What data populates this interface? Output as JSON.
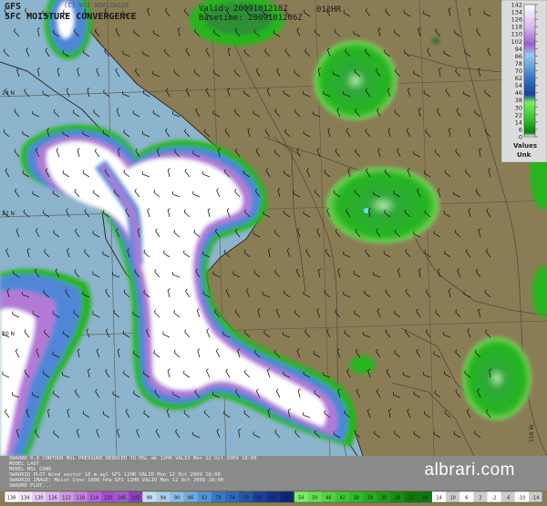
{
  "header": {
    "model": "GFS",
    "product": "SFC MOISTURE CONVERGENCE",
    "copyright": "(C) WSI WORLDWIDE",
    "valid": "Valid: 2009101218Z",
    "basetime": "Basetime: 2009101206Z",
    "forecast_hour": "012HR"
  },
  "legend": {
    "ticks": [
      "142",
      "134",
      "126",
      "118",
      "110",
      "102",
      "94",
      "86",
      "78",
      "70",
      "62",
      "54",
      "46",
      "38",
      "30",
      "22",
      "14",
      "6",
      "0"
    ],
    "caption_line1": "Values",
    "caption_line2": "Unk"
  },
  "latitude_labels": [
    "24 N",
    "22 N",
    "20 N"
  ],
  "longitude_labels": [
    "116 W"
  ],
  "info_lines": [
    "SWAORD 0.0 CONTOUR MSL PRESSURE REDUCED TO MSL mb 12HR VALID Mon 12 Oct 2009 18:00",
    "MODEL LAST",
    "MODEL MSL CONV",
    "SWAORID PLOT Wind vector 10 m agl GFS 12HR VALID Mon 12 Oct 2009 18:00",
    "SWAORID IMAGE: Moist Conv 1000 hPa GFS 12HR VALID Mon 12 Oct 2009 18:00",
    "SWAORD PLOT..."
  ],
  "bottom_colorbar": {
    "labels": [
      "138",
      "134",
      "130",
      "126",
      "122",
      "118",
      "114",
      "110",
      "106",
      "102",
      "98",
      "94",
      "90",
      "86",
      "82",
      "78",
      "74",
      "70",
      "66",
      "62",
      "58",
      "54",
      "50",
      "46",
      "42",
      "38",
      "34",
      "30",
      "26",
      "22",
      "18",
      "14",
      "10",
      "6",
      "2",
      "-2",
      "-6",
      "-10",
      "-14"
    ]
  },
  "watermark": "albrari.com",
  "colors": {
    "land": "#8a7d55",
    "sea": "#8cb4cc",
    "green": "#25b51f",
    "purple": "#b27ad6",
    "white": "#ffffff",
    "blue_core": "#4f86d8"
  }
}
